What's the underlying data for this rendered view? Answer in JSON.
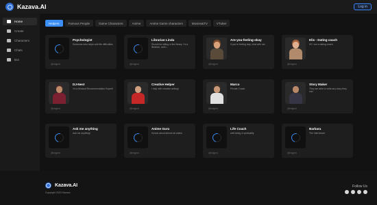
{
  "header": {
    "brand": "Kazava.AI",
    "login_label": "Log in"
  },
  "sidebar": {
    "items": [
      {
        "label": "Home",
        "icon": "home-icon",
        "active": true
      },
      {
        "label": "Create",
        "icon": "create-icon",
        "active": false
      },
      {
        "label": "Characters",
        "icon": "characters-icon",
        "active": false
      },
      {
        "label": "Chats",
        "icon": "chats-icon",
        "active": false
      },
      {
        "label": "Bot",
        "icon": "bot-icon",
        "active": false
      }
    ]
  },
  "tabs": [
    {
      "label": "Helpers",
      "active": true
    },
    {
      "label": "Famous People",
      "active": false
    },
    {
      "label": "Game Characters",
      "active": false
    },
    {
      "label": "Anime",
      "active": false
    },
    {
      "label": "Anime Game characters",
      "active": false
    },
    {
      "label": "Movies&TV",
      "active": false
    },
    {
      "label": "VTuber",
      "active": false
    }
  ],
  "cards": [
    {
      "title": "Psychologist",
      "desc": "Someone who helps with life difficulties",
      "creator": "@Imigent",
      "avatar": "spinner"
    },
    {
      "title": "Librarian Linda",
      "desc": "Should be sitting in the library. I'm a librarian, and I...",
      "creator": "@Imigent",
      "avatar": "spinner"
    },
    {
      "title": "Are-you-feeling-okay",
      "desc": "If you're feeling lazy, chat with me.",
      "creator": "@Imigent",
      "avatar": "portrait",
      "hair": "#7a4a2a",
      "skin": "#d9a27a",
      "shirt": "#5a4a3a"
    },
    {
      "title": "Elis - Dating coach",
      "desc": "Hi! I am a dating coach",
      "creator": "@Imigent",
      "avatar": "portrait",
      "hair": "#a0603a",
      "skin": "#e0b090",
      "shirt": "#b08a6a"
    },
    {
      "title": "DJ-Nest",
      "desc": "I'm a Musical Recommendation Expert!",
      "creator": "@Imigent",
      "avatar": "portrait",
      "hair": "#3a2a2a",
      "skin": "#c08a6a",
      "shirt": "#7a2030"
    },
    {
      "title": "Creative Helper",
      "desc": "I help with creative writing!",
      "creator": "@Imigent",
      "avatar": "portrait",
      "hair": "#2a2a2a",
      "skin": "#d0a080",
      "shirt": "#c62828"
    },
    {
      "title": "Marco",
      "desc": "Private Coach",
      "creator": "@Imigent",
      "avatar": "portrait",
      "hair": "#3a3028",
      "skin": "#c89878",
      "shirt": "#e0e0e0"
    },
    {
      "title": "Story Maker",
      "desc": "They are able to write any story they can",
      "creator": "@Imigent",
      "avatar": "portrait",
      "hair": "#2a2a30",
      "skin": "#b88868",
      "shirt": "#353545"
    },
    {
      "title": "Ask me anything",
      "desc": "Ask me anything!",
      "creator": "@Imigent",
      "avatar": "spinner"
    },
    {
      "title": "Anime Guru",
      "desc": "Knows about almost all anime",
      "creator": "@Imigent",
      "avatar": "spinner"
    },
    {
      "title": "Life Coach",
      "desc": "well-being & spirituality",
      "creator": "@Imigent",
      "avatar": "spinner"
    },
    {
      "title": "Barbara",
      "desc": "The Interviewer",
      "creator": "@Imigent",
      "avatar": "spinner"
    }
  ],
  "footer": {
    "brand": "Kazava.AI",
    "copyright": "Copyright 2023 Kazava",
    "follow": "Follow Us",
    "social": [
      "discord-icon",
      "youtube-icon",
      "twitter-icon",
      "reddit-icon"
    ]
  },
  "colors": {
    "accent": "#3a8ef5",
    "background": "#141414",
    "card": "#1e1e1e"
  }
}
